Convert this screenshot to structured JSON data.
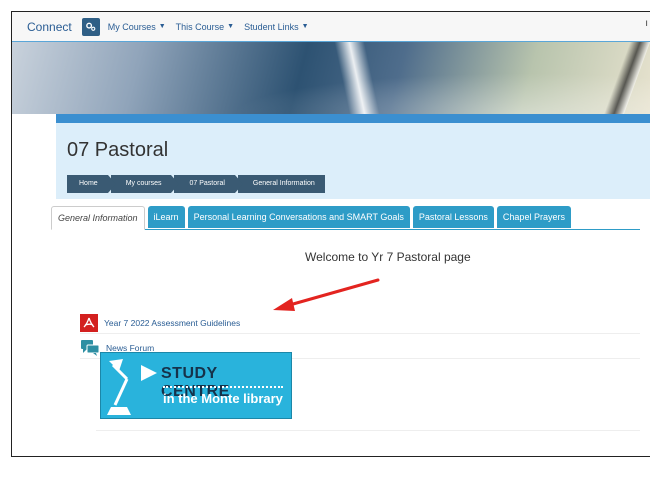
{
  "nav": {
    "brand": "Connect",
    "links": [
      "My Courses",
      "This Course",
      "Student Links"
    ]
  },
  "course": {
    "title": "07 Pastoral",
    "breadcrumbs": [
      "Home",
      "My courses",
      "07 Pastoral",
      "General Information"
    ]
  },
  "tabs": [
    "General Information",
    "iLearn",
    "Personal Learning Conversations and SMART Goals",
    "Pastoral Lessons",
    "Chapel Prayers"
  ],
  "active_tab": "General Information",
  "welcome": "Welcome to Yr 7 Pastoral page",
  "activities": [
    {
      "label": "Year 7 2022 Assessment Guidelines",
      "icon": "pdf-icon"
    },
    {
      "label": "News Forum",
      "icon": "forum-icon"
    }
  ],
  "study_centre": {
    "title": "STUDY CENTRE",
    "subtitle": "in the Monte library"
  },
  "colors": {
    "nav_blue": "#2a5d94",
    "tab_blue": "#2e9cc7",
    "breadcrumb": "#3a5a73",
    "panel_bg": "#dceefa",
    "pdf_red": "#d3201f",
    "arrow_red": "#e32420",
    "study_bg": "#29b3dc"
  }
}
